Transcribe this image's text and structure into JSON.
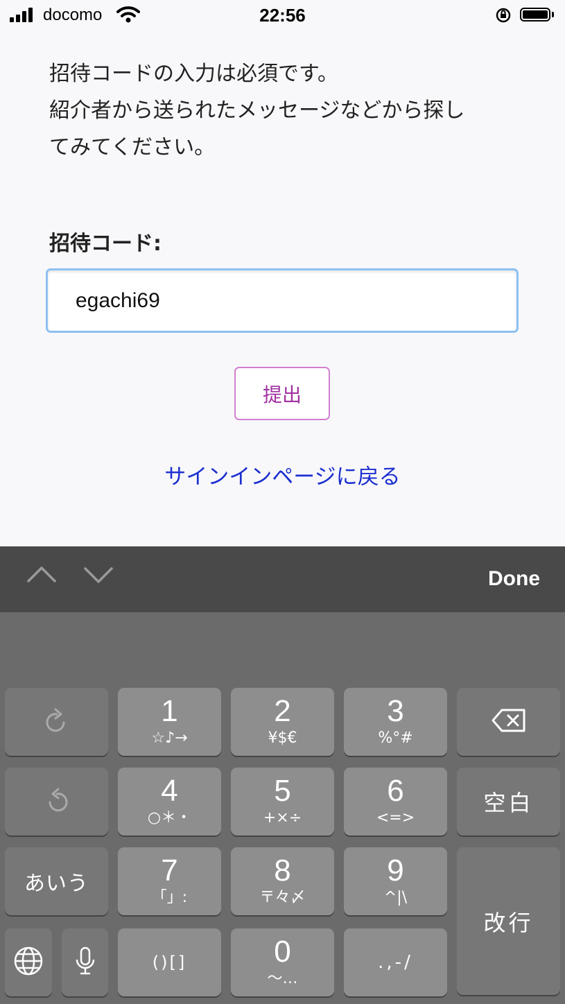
{
  "status_bar": {
    "carrier": "docomo",
    "time": "22:56",
    "icons": [
      "signal-icon",
      "wifi-icon",
      "rotation-lock-icon",
      "battery-icon"
    ]
  },
  "form": {
    "intro_lines": [
      "招待コードの入力は必須です。",
      "紹介者から送られたメッセージなどから探し",
      "てみてください。"
    ],
    "code_label": "招待コード:",
    "code_value": "egachi69",
    "submit_label": "提出",
    "back_link": "サインインページに戻る"
  },
  "accessory_bar": {
    "done_label": "Done",
    "icons": [
      "chevron-up-icon",
      "chevron-down-icon"
    ]
  },
  "keyboard": {
    "keys": [
      {
        "num": "1",
        "sub": "☆♪→"
      },
      {
        "num": "2",
        "sub": "¥$€"
      },
      {
        "num": "3",
        "sub": "%°#"
      },
      {
        "num": "4",
        "sub": "○＊・"
      },
      {
        "num": "5",
        "sub": "+×÷"
      },
      {
        "num": "6",
        "sub": "<=>"
      },
      {
        "num": "7",
        "sub": "「」:"
      },
      {
        "num": "8",
        "sub": "〒々〆"
      },
      {
        "num": "9",
        "sub": "^|\\"
      },
      {
        "num": "0",
        "sub": "〜…"
      }
    ],
    "paren_key": "()[]",
    "punct_key": ".,-/",
    "space_key": "空白",
    "return_key": "改行",
    "kana_key": "あいう"
  },
  "colors": {
    "accent_focus": "#8ec0f2",
    "submit_text": "#a030a0",
    "link": "#1b2fd0",
    "keyboard_bg": "#6b6b6b",
    "accessory_bg": "#494949"
  }
}
